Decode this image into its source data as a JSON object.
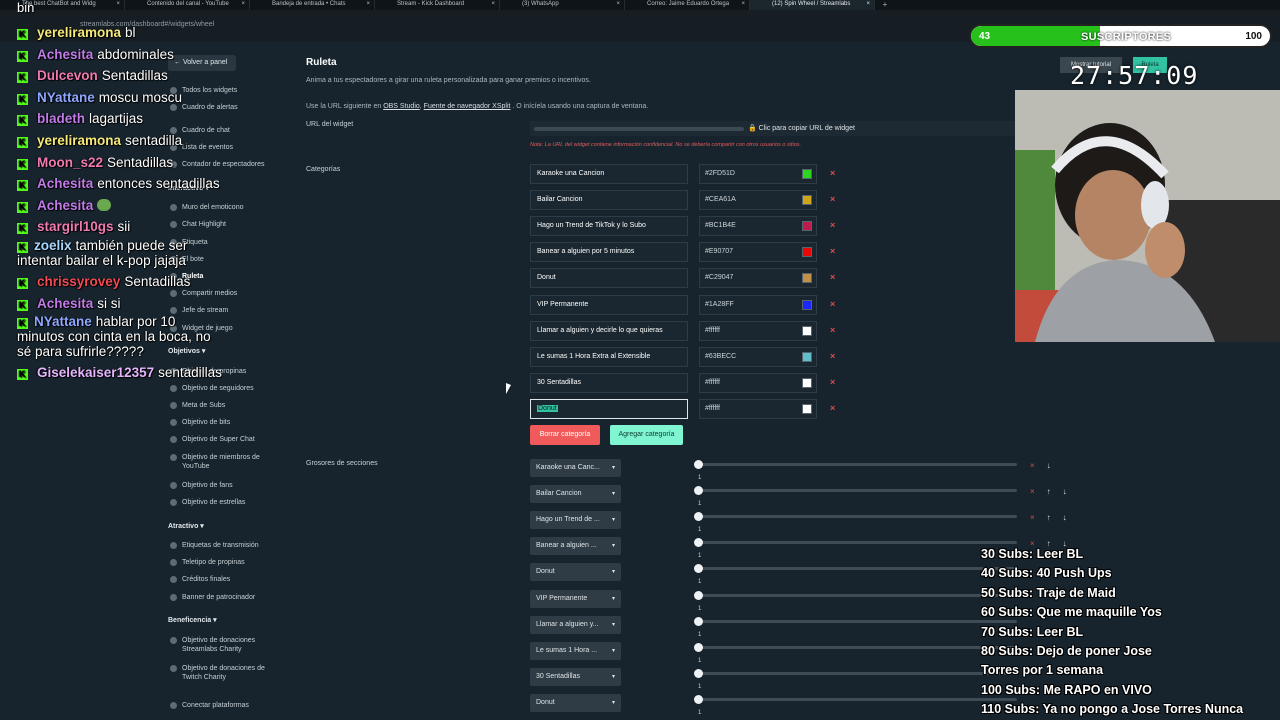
{
  "browser": {
    "tabs": [
      {
        "label": "The best ChatBot and Widg"
      },
      {
        "label": "Contenido del canal - YouTube"
      },
      {
        "label": "Bandeja de entrada • Chats"
      },
      {
        "label": "Stream - Kick Dashboard"
      },
      {
        "label": "(3) WhatsApp"
      },
      {
        "label": "Correo: Jaime Eduardo Ortega"
      },
      {
        "label": "(12) Spin Wheel / Streamlabs"
      }
    ],
    "new_tab": "+",
    "url": "streamlabs.com/dashboard#/widgets/wheel"
  },
  "overlay_top_word": "bin",
  "chat": [
    {
      "user": "yereliramona",
      "color": "#f5ea7a",
      "text": "bl"
    },
    {
      "user": "Achesita",
      "color": "#c07be8",
      "text": "abdominales"
    },
    {
      "user": "Dulcevon",
      "color": "#f07bb0",
      "text": "Sentadillas"
    },
    {
      "user": "NYattane",
      "color": "#8ea8ff",
      "text": "moscu moscu"
    },
    {
      "user": "bladeth",
      "color": "#c07be8",
      "text": "lagartijas"
    },
    {
      "user": "yereliramona",
      "color": "#f5ea7a",
      "text": "sentadilla"
    },
    {
      "user": "Moon_s22",
      "color": "#f07bb0",
      "text": "Sentadillas"
    },
    {
      "user": "Achesita",
      "color": "#c07be8",
      "text": "entonces sentadillas"
    },
    {
      "user": "Achesita",
      "color": "#c07be8",
      "text": ""
    },
    {
      "user": "stargirl10gs",
      "color": "#f07bb0",
      "text": "sii"
    },
    {
      "user": "zoelix",
      "color": "#a9d8ff",
      "text": "también puede ser intentar bailar el k-pop jajaja"
    },
    {
      "user": "chrissyrovey",
      "color": "#f24a55",
      "text": "Sentadillas"
    },
    {
      "user": "Achesita",
      "color": "#c07be8",
      "text": "si si"
    },
    {
      "user": "NYattane",
      "color": "#8ea8ff",
      "text": "hablar por 10 minutos con cinta en la boca, no sé para sufrirle?????"
    },
    {
      "user": "Giselekaiser12357",
      "color": "#e5b5ff",
      "text": "sentadillas"
    }
  ],
  "nav": {
    "back_label": "Volver a panel",
    "items": [
      {
        "label": "Todos los widgets"
      },
      {
        "label": "Cuadro de alertas"
      },
      {
        "label": "Cuadro de chat"
      },
      {
        "label": "Lista de eventos"
      },
      {
        "label": "Contador de espectadores"
      },
      {
        "label": "Muro del emoticono"
      },
      {
        "label": "Chat Highlight"
      },
      {
        "label": "Etiqueta"
      },
      {
        "label": "El bote"
      },
      {
        "label": "Ruleta"
      },
      {
        "label": "Compartir medios"
      },
      {
        "label": "Jefe de stream"
      },
      {
        "label": "Widget de juego"
      },
      {
        "label": "Objetivo de propinas"
      },
      {
        "label": "Objetivo de seguidores"
      },
      {
        "label": "Meta de Subs"
      },
      {
        "label": "Objetivo de bits"
      },
      {
        "label": "Objetivo de Super Chat"
      },
      {
        "label": "Objetivo de miembros de YouTube"
      },
      {
        "label": "Objetivo de fans"
      },
      {
        "label": "Objetivo de estrellas"
      },
      {
        "label": "Etiquetas de transmisión"
      },
      {
        "label": "Teletipo de propinas"
      },
      {
        "label": "Créditos finales"
      },
      {
        "label": "Banner de patrocinador"
      },
      {
        "label": "Objetivo de donaciones Streamlabs Charity"
      },
      {
        "label": "Objetivo de donaciones de Twitch Charity"
      },
      {
        "label": "Conectar plataformas"
      }
    ],
    "sections": {
      "interactivo": "Interactivo",
      "objetivos": "Objetivos",
      "atractivo": "Atractivo",
      "beneficencia": "Beneficencia"
    }
  },
  "main": {
    "title": "Ruleta",
    "desc1": "Anima a tus espectadores a girar una ruleta personalizada para ganar premios o incentivos.",
    "desc2_pre": "Use la URL siguiente en",
    "desc2_link1": "OBS Studio",
    "desc2_sep": ",",
    "desc2_link2": "Fuente de navegador XSplit",
    "desc2_post": ". O inícíela usando una captura de ventana.",
    "url_label": "URL del widget",
    "url_copy": "Clic para copiar URL de widget",
    "url_warning": "Nota: La URL del widget contiene información confidencial. No se debería compartir con otros usuarios o sitios.",
    "categories_label": "Categorías",
    "categories": [
      {
        "name": "Karaoke una Cancion",
        "color": "#2FD51D"
      },
      {
        "name": "Bailar Cancion",
        "color": "#CEA61A"
      },
      {
        "name": "Hago un Trend de TikTok y lo Subo",
        "color": "#BC1B4E"
      },
      {
        "name": "Banear a alguien por 5 minutos",
        "color": "#E90707"
      },
      {
        "name": "Donut",
        "color": "#C29047"
      },
      {
        "name": "VIP Permanente",
        "color": "#1A28FF"
      },
      {
        "name": "Llamar a alguien y decirle lo que quieras",
        "color": "#ffffff"
      },
      {
        "name": "Le sumas 1 Hora Extra al Extensible",
        "color": "#63BECC"
      },
      {
        "name": "30 Sentadillas",
        "color": "#ffffff"
      },
      {
        "name": "Donut",
        "color": "#ffffff"
      }
    ],
    "delete_glyph": "×",
    "btn_remove": "Borrar categoría",
    "btn_add": "Agregar categoría",
    "sections_label": "Grosores de secciones",
    "sections": [
      {
        "label": "Karaoke una Canc...",
        "value": "1"
      },
      {
        "label": "Bailar Cancion",
        "value": "1"
      },
      {
        "label": "Hago un Trend de ...",
        "value": "1"
      },
      {
        "label": "Banear a alguien ...",
        "value": "1"
      },
      {
        "label": "Donut",
        "value": "1"
      },
      {
        "label": "VIP Permanente",
        "value": "1"
      },
      {
        "label": "Llamar a alguien y...",
        "value": "1"
      },
      {
        "label": "Le sumas 1 Hora ...",
        "value": "1"
      },
      {
        "label": "30 Sentadillas",
        "value": "1"
      },
      {
        "label": "Donut",
        "value": "1"
      }
    ],
    "caret": "▾",
    "arrow_up": "↑",
    "arrow_down": "↓"
  },
  "subgoal": {
    "current": "43",
    "label": "SUSCRIPTORES",
    "max": "100",
    "progress": 0.43
  },
  "header_buttons": {
    "tutorial": "Mostrar tutorial",
    "preview": "Ruleta"
  },
  "timer": "27:57:09",
  "goals": [
    "30 Subs: Leer BL",
    "40 Subs: 40 Push Ups",
    "50 Subs: Traje de Maid",
    "60 Subs: Que me maquille Yos",
    "70 Subs: Leer BL",
    "80 Subs: Dejo de poner Jose",
    "Torres por 1 semana",
    "100 Subs: Me RAPO en VIVO",
    "110 Subs: Ya no pongo a Jose Torres Nunca"
  ]
}
